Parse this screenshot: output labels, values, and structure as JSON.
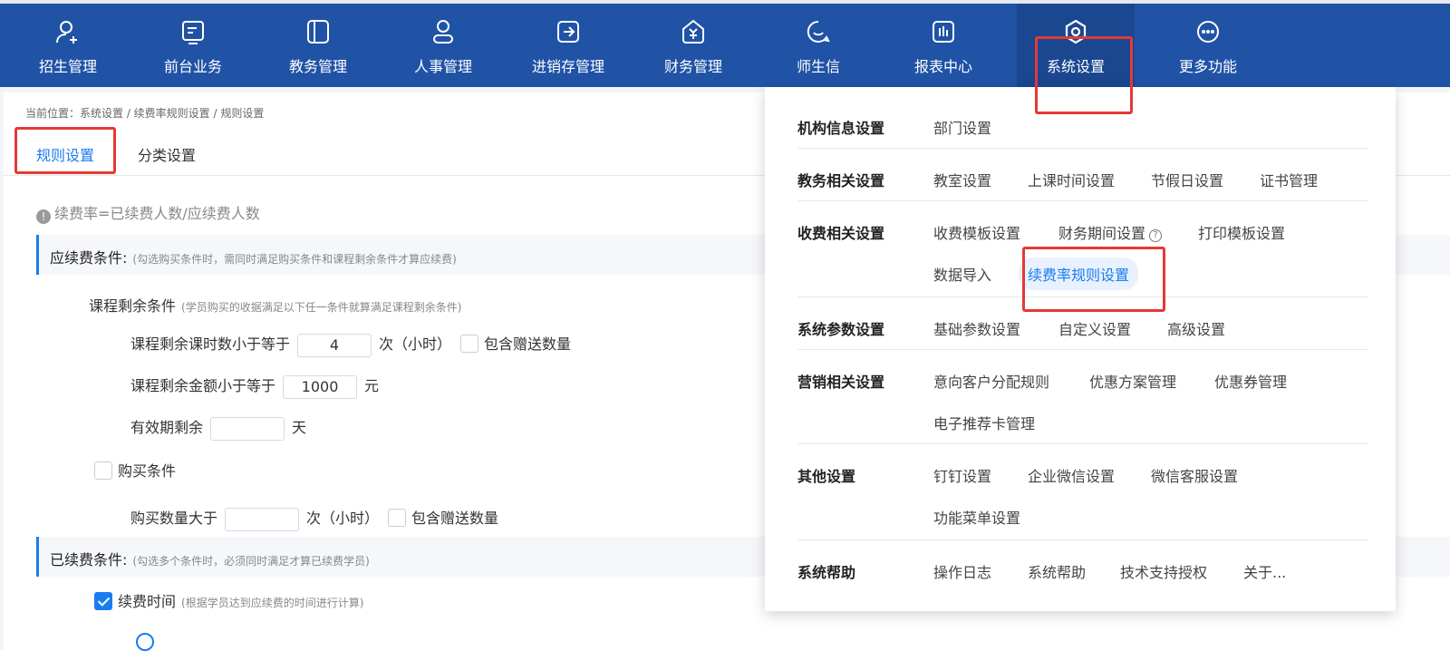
{
  "nav": {
    "items": [
      {
        "label": "招生管理",
        "icon": "user-plus-icon"
      },
      {
        "label": "前台业务",
        "icon": "desk-icon"
      },
      {
        "label": "教务管理",
        "icon": "book-icon"
      },
      {
        "label": "人事管理",
        "icon": "person-icon"
      },
      {
        "label": "进销存管理",
        "icon": "inventory-icon"
      },
      {
        "label": "财务管理",
        "icon": "finance-icon"
      },
      {
        "label": "师生信",
        "icon": "chat-icon"
      },
      {
        "label": "报表中心",
        "icon": "report-icon"
      },
      {
        "label": "系统设置",
        "icon": "gear-icon"
      },
      {
        "label": "更多功能",
        "icon": "more-icon"
      }
    ],
    "active": "系统设置"
  },
  "breadcrumb": "当前位置：系统设置 / 续费率规则设置 / 规则设置",
  "tabs": {
    "rules": "规则设置",
    "category": "分类设置"
  },
  "formula_note": "续费率=已续费人数/应续费人数",
  "should_renew": {
    "title": "应续费条件:",
    "subtitle": "(勾选购买条件时，需同时满足购买条件和课程剩余条件才算应续费)",
    "course_remaining": {
      "title": "课程剩余条件",
      "subtitle": "(学员购买的收据满足以下任一条件就算满足课程剩余条件)",
      "hours_label": "课程剩余课时数小于等于",
      "hours_value": "4",
      "hours_unit": "次（小时）",
      "include_gift_label": "包含赠送数量",
      "amount_label": "课程剩余金额小于等于",
      "amount_value": "1000",
      "amount_unit": "元",
      "validity_label": "有效期剩余",
      "validity_value": "",
      "validity_unit": "天"
    },
    "purchase": {
      "checkbox_label": "购买条件",
      "qty_label": "购买数量大于",
      "qty_value": "",
      "qty_unit": "次（小时）",
      "include_gift_label": "包含赠送数量"
    }
  },
  "renewed": {
    "title": "已续费条件:",
    "subtitle": "(勾选多个条件时，必须同时满足才算已续费学员)",
    "renew_time_label": "续费时间",
    "renew_time_sub": "(根据学员达到应续费的时间进行计算)"
  },
  "dropdown": {
    "groups": [
      {
        "title": "机构信息设置",
        "links": [
          "部门设置"
        ]
      },
      {
        "title": "教务相关设置",
        "links": [
          "教室设置",
          "上课时间设置",
          "节假日设置",
          "证书管理"
        ]
      },
      {
        "title": "收费相关设置",
        "links": [
          "收费模板设置",
          "财务期间设置",
          "打印模板设置",
          "数据导入",
          "续费率规则设置"
        ]
      },
      {
        "title": "系统参数设置",
        "links": [
          "基础参数设置",
          "自定义设置",
          "高级设置"
        ]
      },
      {
        "title": "营销相关设置",
        "links": [
          "意向客户分配规则",
          "优惠方案管理",
          "优惠券管理",
          "电子推荐卡管理"
        ]
      },
      {
        "title": "其他设置",
        "links": [
          "钉钉设置",
          "企业微信设置",
          "微信客服设置",
          "功能菜单设置"
        ]
      },
      {
        "title": "系统帮助",
        "links": [
          "操作日志",
          "系统帮助",
          "技术支持授权",
          "关于..."
        ]
      }
    ],
    "highlighted": "续费率规则设置",
    "help_icon": "question-circle-icon"
  },
  "colors": {
    "nav_bg": "#2053a6",
    "accent": "#1a7cf0",
    "annotation": "#e53935"
  }
}
